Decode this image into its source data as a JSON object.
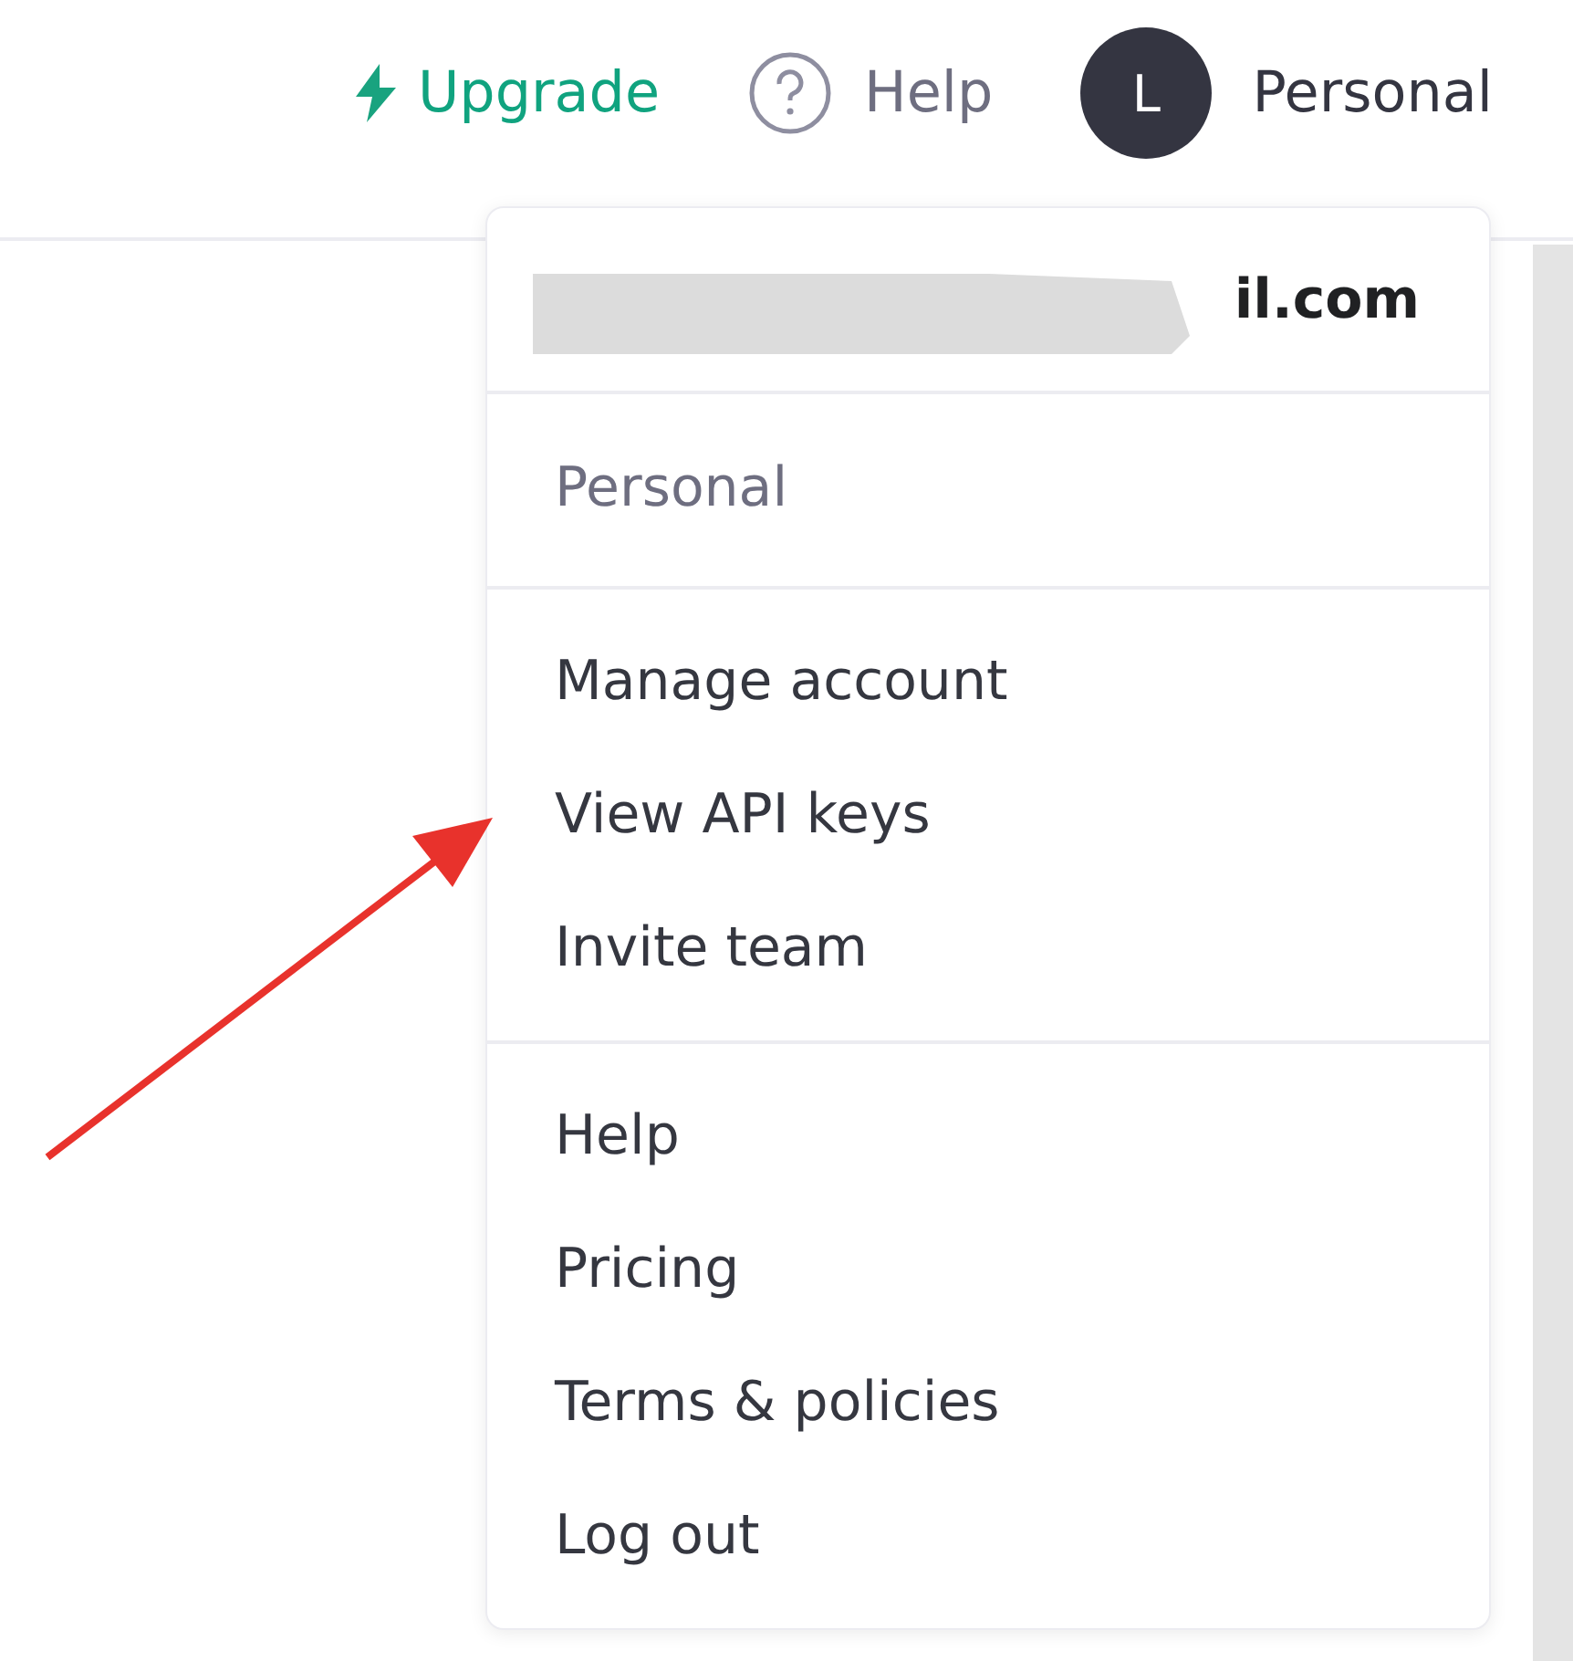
{
  "header": {
    "upgrade": "Upgrade",
    "help": "Help",
    "avatar_initial": "L",
    "account": "Personal"
  },
  "menu": {
    "email": "il.com",
    "org": "Personal",
    "sections": [
      [
        "Manage account",
        "View API keys",
        "Invite team"
      ],
      [
        "Help",
        "Pricing",
        "Terms & policies",
        "Log out"
      ]
    ]
  }
}
